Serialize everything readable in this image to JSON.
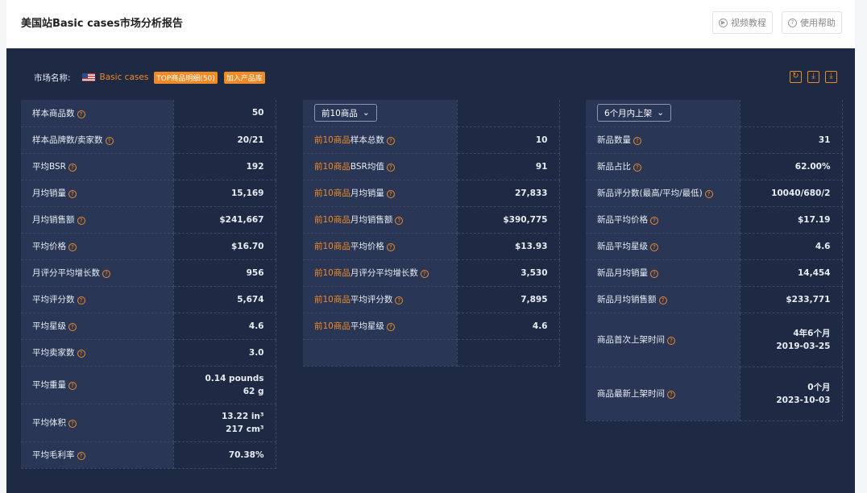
{
  "header": {
    "title": "美国站Basic cases市场分析报告",
    "video_btn": "视频教程",
    "help_btn": "使用帮助"
  },
  "market": {
    "label": "市场名称:",
    "name": "Basic cases",
    "tag_top": "TOP商品明细(50)",
    "tag_add": "加入产品库"
  },
  "col1": [
    {
      "label": "样本商品数",
      "value": "50"
    },
    {
      "label": "样本品牌数/卖家数",
      "value": "20/21"
    },
    {
      "label": "平均BSR",
      "value": "192"
    },
    {
      "label": "月均销量",
      "value": "15,169"
    },
    {
      "label": "月均销售额",
      "value": "$241,667"
    },
    {
      "label": "平均价格",
      "value": "$16.70"
    },
    {
      "label": "月评分平均增长数",
      "value": "956"
    },
    {
      "label": "平均评分数",
      "value": "5,674"
    },
    {
      "label": "平均星级",
      "value": "4.6"
    },
    {
      "label": "平均卖家数",
      "value": "3.0"
    },
    {
      "label": "平均重量",
      "value": "0.14 pounds",
      "value2": "62 g"
    },
    {
      "label": "平均体积",
      "value": "13.22 in³",
      "value2": "217 cm³"
    },
    {
      "label": "平均毛利率",
      "value": "70.38%"
    }
  ],
  "col2": {
    "select": "前10商品",
    "prefix": "前10商品",
    "rows": [
      {
        "label": "样本总数",
        "value": "10"
      },
      {
        "label": "BSR均值",
        "value": "91"
      },
      {
        "label": "月均销量",
        "value": "27,833"
      },
      {
        "label": "月均销售额",
        "value": "$390,775"
      },
      {
        "label": "平均价格",
        "value": "$13.93"
      },
      {
        "label": "月评分平均增长数",
        "value": "3,530"
      },
      {
        "label": "平均评分数",
        "value": "7,895"
      },
      {
        "label": "平均星级",
        "value": "4.6"
      }
    ]
  },
  "col3": {
    "select": "6个月内上架",
    "rows": [
      {
        "label": "新品数量",
        "value": "31"
      },
      {
        "label": "新品占比",
        "value": "62.00%"
      },
      {
        "label": "新品评分数(最高/平均/最低)",
        "value": "10040/680/2"
      },
      {
        "label": "新品平均价格",
        "value": "$17.19"
      },
      {
        "label": "新品平均星级",
        "value": "4.6"
      },
      {
        "label": "新品月均销量",
        "value": "14,454"
      },
      {
        "label": "新品月均销售额",
        "value": "$233,771"
      },
      {
        "label": "商品首次上架时间",
        "value": "4年6个月",
        "value2": "2019-03-25"
      },
      {
        "label": "商品最新上架时间",
        "value": "0个月",
        "value2": "2023-10-03"
      }
    ]
  },
  "colors": {
    "accent": "#f08a24",
    "panel": "#1e2a44",
    "label_bg": "#2a3656"
  }
}
